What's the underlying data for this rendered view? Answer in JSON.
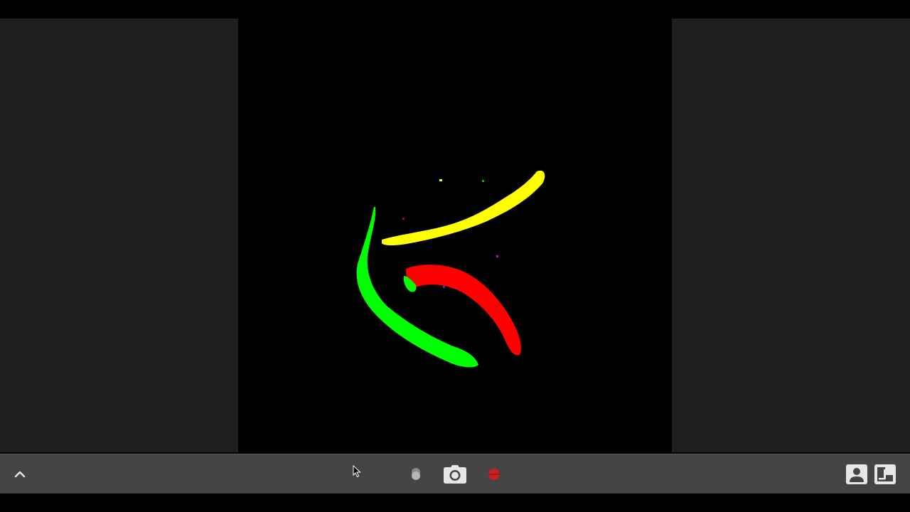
{
  "canvas": {
    "background": "#000000",
    "strokes": [
      {
        "name": "yellow-stroke",
        "color": "#ffff00"
      },
      {
        "name": "green-stroke",
        "color": "#00ff00"
      },
      {
        "name": "red-stroke",
        "color": "#ff0000"
      }
    ]
  },
  "toolbar": {
    "background": "#454545",
    "buttons": [
      {
        "name": "expand-toolbar-button",
        "icon": "chevron-up-icon"
      },
      {
        "name": "overlay-toggle-button",
        "icon": "double-dot-icon"
      },
      {
        "name": "screenshot-button",
        "icon": "camera-icon"
      },
      {
        "name": "record-button",
        "icon": "record-dot-icon",
        "color": "#cc1f1f"
      },
      {
        "name": "gallery-button",
        "icon": "image-icon"
      },
      {
        "name": "picture-in-picture-button",
        "icon": "pip-icon"
      }
    ]
  },
  "colors": {
    "side_panel": "#1e1e1e",
    "icon_light": "#e6e6e6"
  }
}
